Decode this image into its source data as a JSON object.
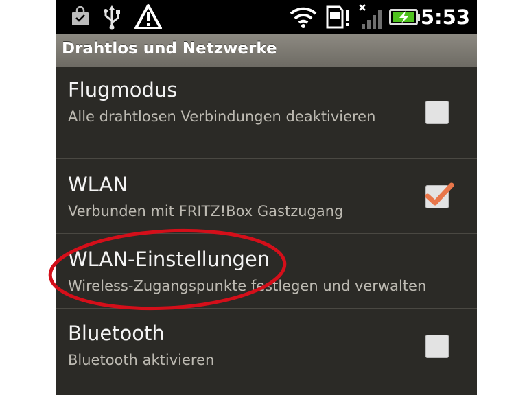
{
  "status_bar": {
    "time": "5:53",
    "icons": [
      "shopping-bag-icon",
      "usb-icon",
      "warning-icon",
      "wifi-icon",
      "sd-card-icon",
      "no-signal-icon",
      "battery-charging-icon"
    ]
  },
  "header": {
    "title": "Drahtlos und Netzwerke"
  },
  "settings": [
    {
      "title": "Flugmodus",
      "summary": "Alle drahtlosen Verbindungen deaktivieren",
      "checked": false
    },
    {
      "title": "WLAN",
      "summary": "Verbunden mit FRITZ!Box Gastzugang",
      "checked": true
    },
    {
      "title": "WLAN-Einstellungen",
      "summary": "Wireless-Zugangspunkte festlegen und verwalten"
    },
    {
      "title": "Bluetooth",
      "summary": "Bluetooth aktivieren",
      "checked": false
    }
  ],
  "colors": {
    "background": "#2b2a26",
    "header": "#7d7a73",
    "checkmark": "#e8764a",
    "highlight": "#d40f1a",
    "battery": "#4fc21f"
  }
}
